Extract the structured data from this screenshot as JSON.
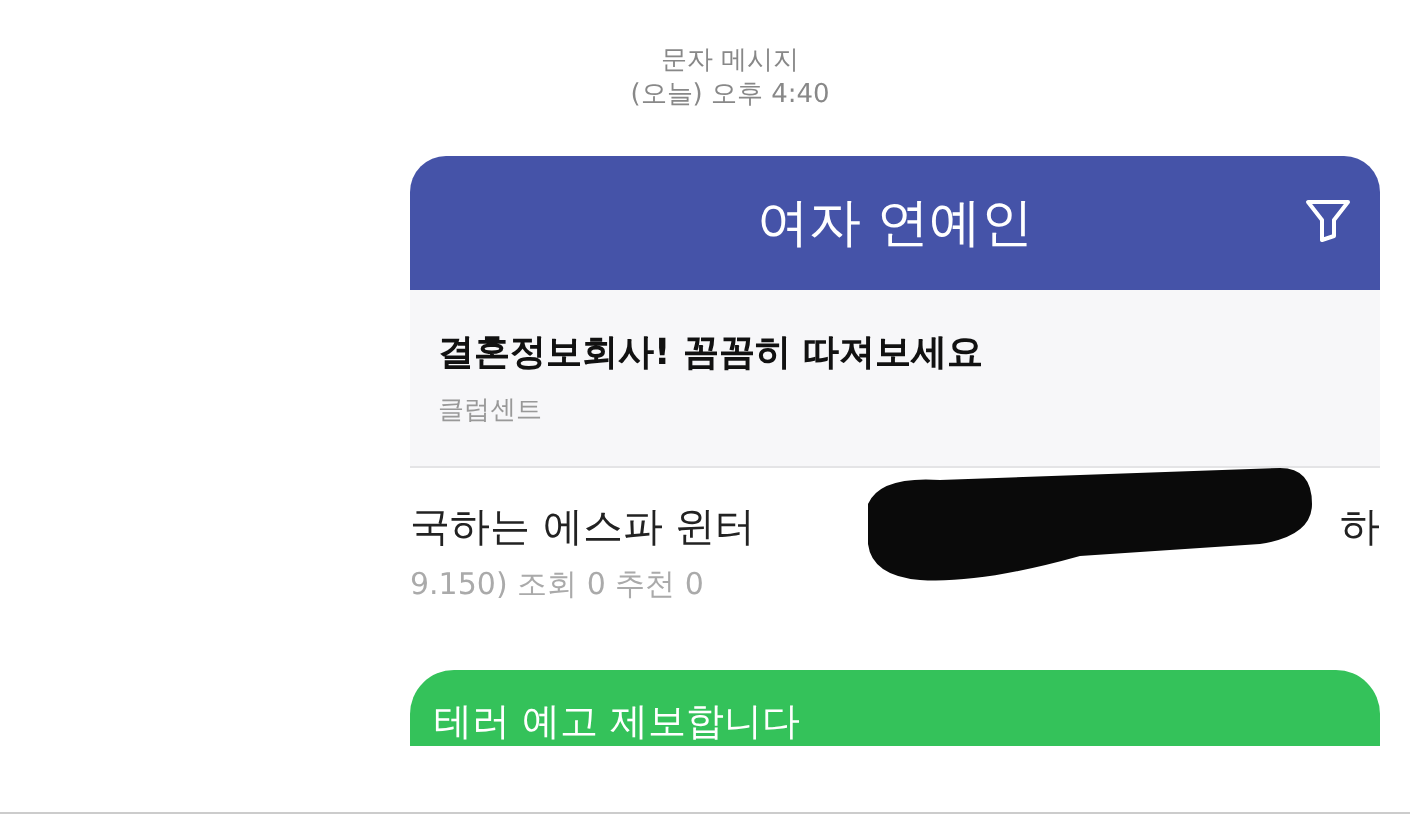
{
  "message_header": {
    "type": "문자 메시지",
    "time": "(오늘) 오후 4:40"
  },
  "image": {
    "board_title": "여자 연예인",
    "ad": {
      "title": "결혼정보회사! 꼼꼼히 따져보세요",
      "source": "클럽센트"
    },
    "post": {
      "title_start": "국하는 에스파 윈터",
      "title_end": "하",
      "meta": "9.150) 조회 0  추천 0",
      "redacted": true
    }
  },
  "reply": {
    "text": "테러 예고 제보합니다"
  }
}
